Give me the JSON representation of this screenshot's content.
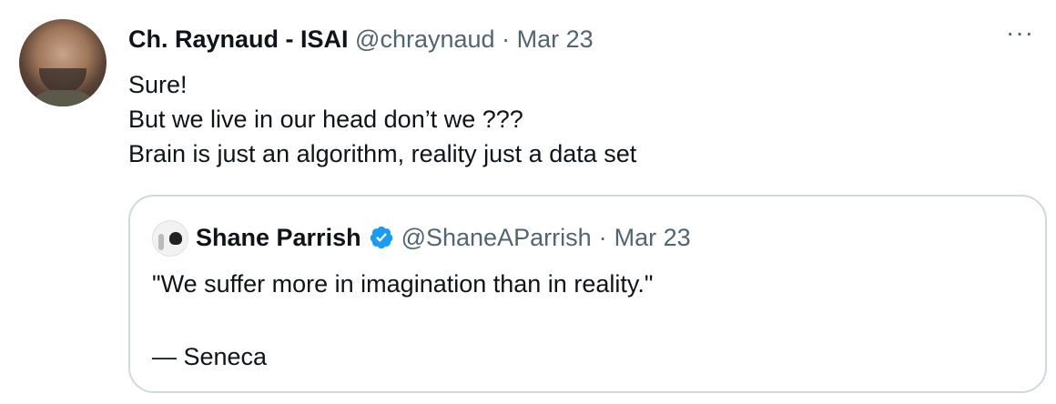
{
  "tweet": {
    "author_name": "Ch. Raynaud - ISAI",
    "handle": "@chraynaud",
    "separator": "·",
    "date": "Mar 23",
    "more_label": "···",
    "lines": [
      "Sure!",
      "But we live in our head don’t we ???",
      "Brain is just an algorithm, reality just a data set"
    ]
  },
  "quoted": {
    "author_name": "Shane Parrish",
    "verified": true,
    "handle": "@ShaneAParrish",
    "separator": "·",
    "date": "Mar 23",
    "lines": [
      "\"We suffer more in imagination than in reality.\"",
      "— Seneca"
    ]
  },
  "colors": {
    "text": "#0f1419",
    "muted": "#536471",
    "border": "#cfd9de",
    "verified": "#1d9bf0"
  },
  "icons": {
    "more": "more-horizontal-icon",
    "verified": "verified-badge-icon"
  }
}
